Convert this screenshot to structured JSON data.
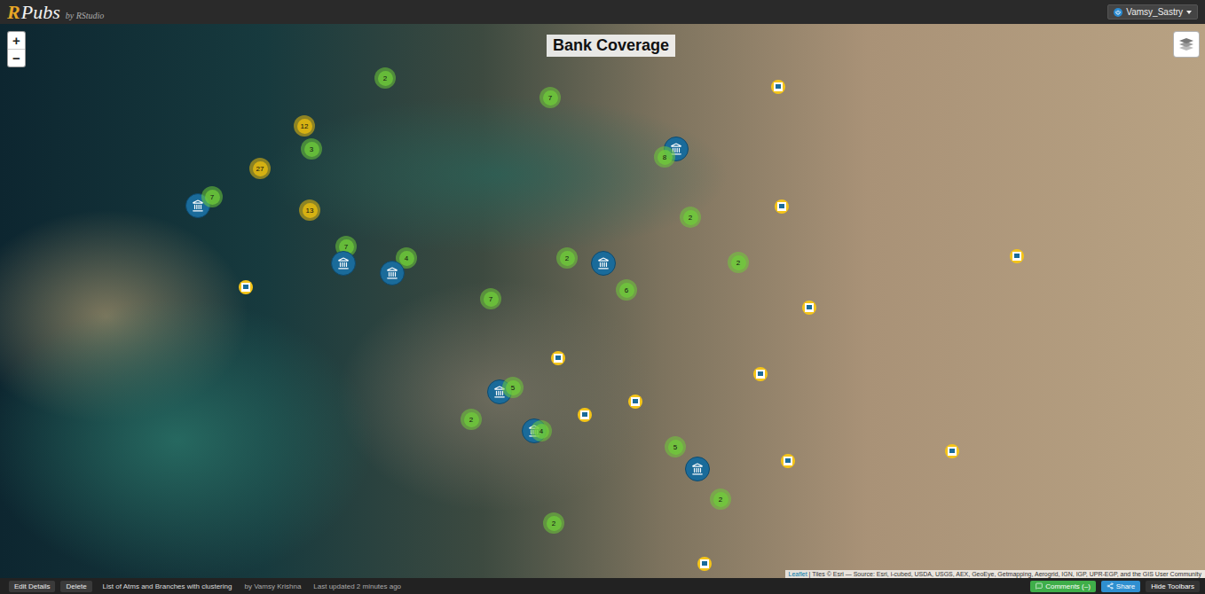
{
  "topbar": {
    "logo": {
      "mark": "R",
      "name": "Pubs",
      "by": "by RStudio"
    },
    "user": "Vamsy_Sastry"
  },
  "map": {
    "title": "Bank Coverage",
    "zoom": [
      "+",
      "−"
    ],
    "markers": [
      {
        "kind": "cluster",
        "count": "2",
        "color": "#6ecc39"
      },
      {
        "kind": "cluster",
        "count": "7",
        "color": "#6ecc39"
      },
      {
        "kind": "cluster",
        "count": "12",
        "color": "#f0c20c"
      },
      {
        "kind": "cluster",
        "count": "3",
        "color": "#6ecc39"
      },
      {
        "kind": "cluster",
        "count": "27",
        "color": "#f0c20c"
      },
      {
        "kind": "bank"
      },
      {
        "kind": "cluster",
        "count": "8",
        "color": "#6ecc39"
      },
      {
        "kind": "bank"
      },
      {
        "kind": "cluster",
        "count": "7",
        "color": "#6ecc39"
      },
      {
        "kind": "cluster",
        "count": "13",
        "color": "#f0c20c"
      },
      {
        "kind": "cluster",
        "count": "2",
        "color": "#6ecc39"
      },
      {
        "kind": "cluster",
        "count": "7",
        "color": "#6ecc39"
      },
      {
        "kind": "bank"
      },
      {
        "kind": "cluster",
        "count": "4",
        "color": "#6ecc39"
      },
      {
        "kind": "bank"
      },
      {
        "kind": "cluster",
        "count": "2",
        "color": "#6ecc39"
      },
      {
        "kind": "bank"
      },
      {
        "kind": "cluster",
        "count": "2",
        "color": "#6ecc39"
      },
      {
        "kind": "cluster",
        "count": "6",
        "color": "#6ecc39"
      },
      {
        "kind": "cluster",
        "count": "7",
        "color": "#6ecc39"
      },
      {
        "kind": "bank"
      },
      {
        "kind": "cluster",
        "count": "5",
        "color": "#6ecc39"
      },
      {
        "kind": "cluster",
        "count": "2",
        "color": "#6ecc39"
      },
      {
        "kind": "bank"
      },
      {
        "kind": "cluster",
        "count": "4",
        "color": "#6ecc39"
      },
      {
        "kind": "cluster",
        "count": "5",
        "color": "#6ecc39"
      },
      {
        "kind": "bank"
      },
      {
        "kind": "cluster",
        "count": "2",
        "color": "#6ecc39"
      },
      {
        "kind": "cluster",
        "count": "2",
        "color": "#6ecc39"
      },
      {
        "kind": "atm"
      },
      {
        "kind": "atm"
      },
      {
        "kind": "atm"
      },
      {
        "kind": "atm"
      },
      {
        "kind": "atm"
      },
      {
        "kind": "atm"
      },
      {
        "kind": "atm"
      },
      {
        "kind": "atm"
      },
      {
        "kind": "atm"
      },
      {
        "kind": "atm"
      },
      {
        "kind": "atm"
      },
      {
        "kind": "atm"
      }
    ],
    "attribution": {
      "link": "Leaflet",
      "text": " | Tiles © Esri — Source: Esri, i-cubed, USDA, USGS, AEX, GeoEye, Getmapping, Aerogrid, IGN, IGP, UPR-EGP, and the GIS User Community"
    }
  },
  "bottombar": {
    "buttons": [
      "Edit Details",
      "Delete"
    ],
    "doc_title": "List of Atms and Branches with clustering",
    "author": "by Vamsy Krishna",
    "updated": "Last updated 2 minutes ago",
    "actions": [
      {
        "label": "Comments (–)",
        "color": "#3fae49"
      },
      {
        "label": "Share",
        "color": "#2f8fd0"
      },
      {
        "label": "Hide Toolbars",
        "color": "#333333"
      }
    ]
  }
}
